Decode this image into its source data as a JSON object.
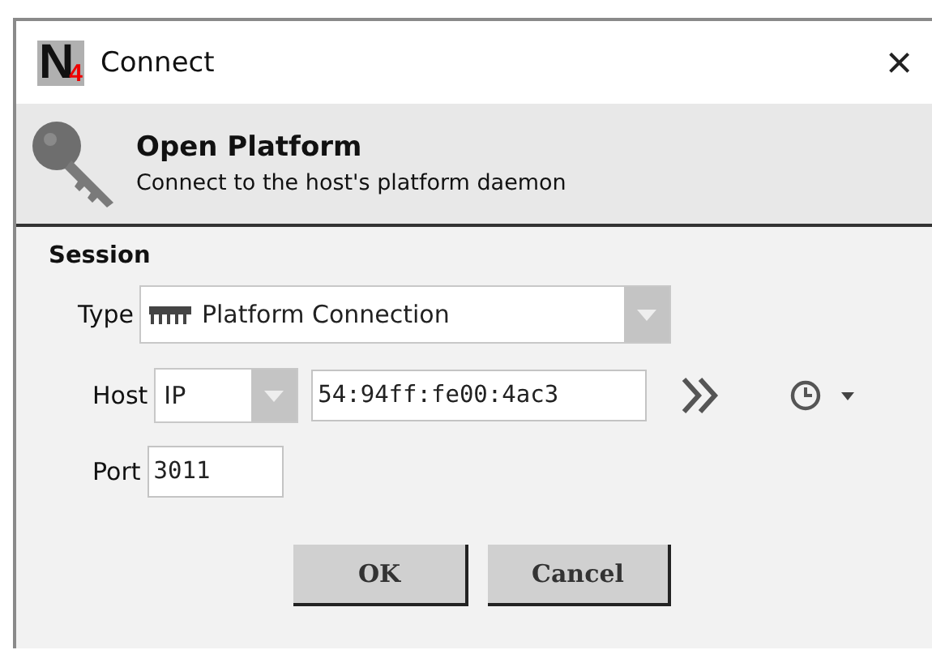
{
  "window": {
    "title": "Connect",
    "close": "×",
    "logo": {
      "letter": "N",
      "digit": "4"
    }
  },
  "header": {
    "title": "Open Platform",
    "subtitle": "Connect to the host's platform daemon"
  },
  "session": {
    "title": "Session",
    "type": {
      "label": "Type",
      "value": "Platform Connection"
    },
    "host": {
      "label": "Host",
      "kind": "IP",
      "value": "54:94ff:fe00:4ac3"
    },
    "port": {
      "label": "Port",
      "value": "3011"
    }
  },
  "buttons": [
    "OK",
    "Cancel"
  ]
}
